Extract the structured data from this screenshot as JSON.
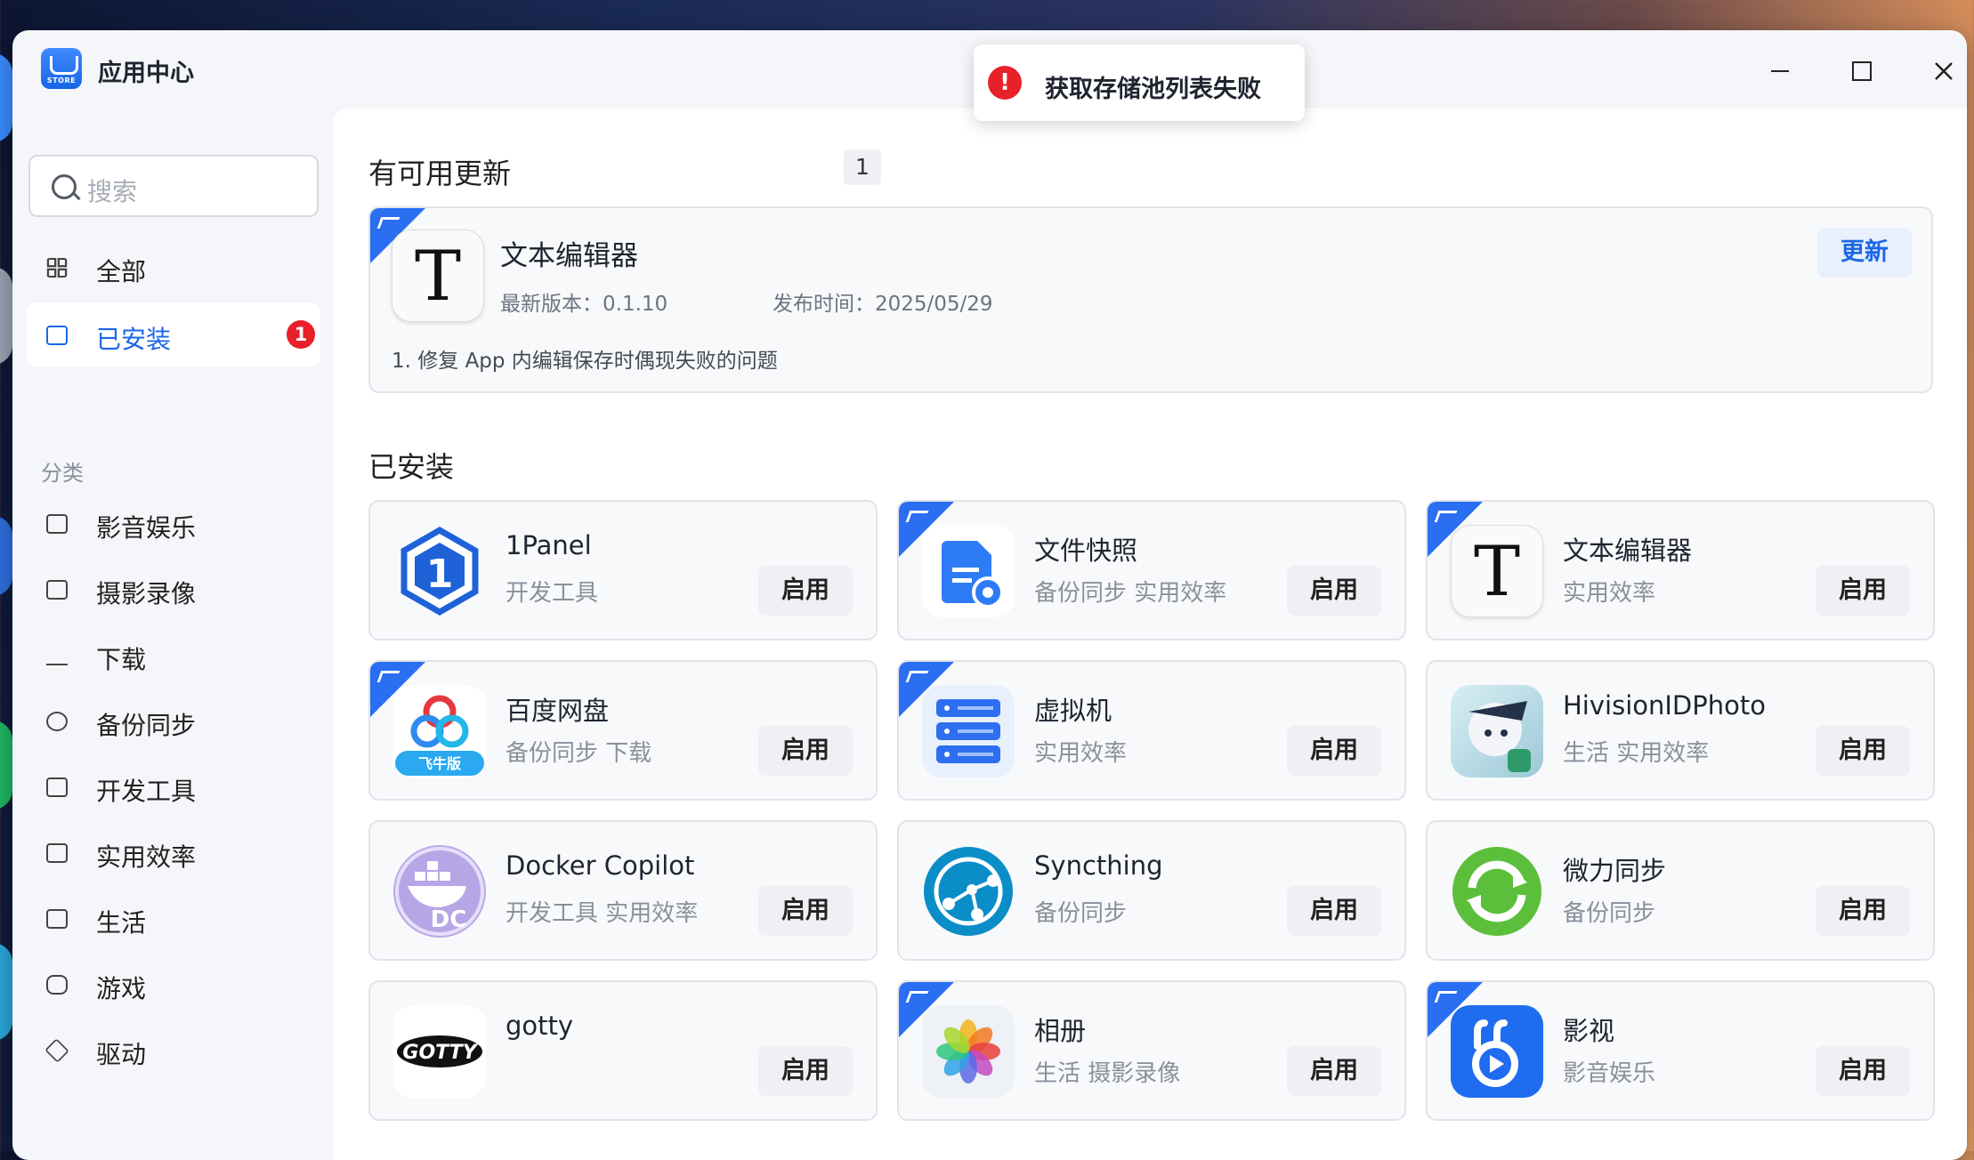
{
  "window": {
    "title": "应用中心",
    "logo_text": "STORE"
  },
  "toast": {
    "message": "获取存储池列表失败"
  },
  "search": {
    "placeholder": "搜索"
  },
  "nav": {
    "all": "全部",
    "installed": "已安装",
    "installed_badge": "1",
    "category_heading": "分类",
    "categories": [
      "影音娱乐",
      "摄影录像",
      "下载",
      "备份同步",
      "开发工具",
      "实用效率",
      "生活",
      "游戏",
      "驱动"
    ]
  },
  "updates": {
    "title": "有可用更新",
    "count": "1",
    "item": {
      "name": "文本编辑器",
      "icon_letter": "T",
      "version": "最新版本：0.1.10",
      "date": "发布时间：2025/05/29",
      "note": "1. 修复 App 内编辑保存时偶现失败的问题",
      "button": "更新"
    }
  },
  "installed": {
    "title": "已安装",
    "button_label": "启用",
    "apps": [
      {
        "name": "1Panel",
        "tags": "开发工具",
        "icon": "1panel-icon"
      },
      {
        "name": "文件快照",
        "tags": "备份同步 实用效率",
        "icon": "file-snapshot-icon"
      },
      {
        "name": "文本编辑器",
        "tags": "实用效率",
        "icon": "text-editor-icon"
      },
      {
        "name": "百度网盘",
        "tags": "备份同步 下载",
        "icon": "baidu-netdisk-icon",
        "icon_label": "飞牛版"
      },
      {
        "name": "虚拟机",
        "tags": "实用效率",
        "icon": "vm-icon"
      },
      {
        "name": "HivisionIDPhoto",
        "tags": "生活 实用效率",
        "icon": "hivision-icon"
      },
      {
        "name": "Docker Copilot",
        "tags": "开发工具 实用效率",
        "icon": "docker-copilot-icon",
        "icon_label": "DC"
      },
      {
        "name": "Syncthing",
        "tags": "备份同步",
        "icon": "syncthing-icon"
      },
      {
        "name": "微力同步",
        "tags": "备份同步",
        "icon": "verysync-icon"
      },
      {
        "name": "gotty",
        "tags": "",
        "icon": "gotty-icon",
        "icon_label": "GOTTY"
      },
      {
        "name": "相册",
        "tags": "生活 摄影录像",
        "icon": "photos-icon"
      },
      {
        "name": "影视",
        "tags": "影音娱乐",
        "icon": "video-icon"
      }
    ]
  }
}
